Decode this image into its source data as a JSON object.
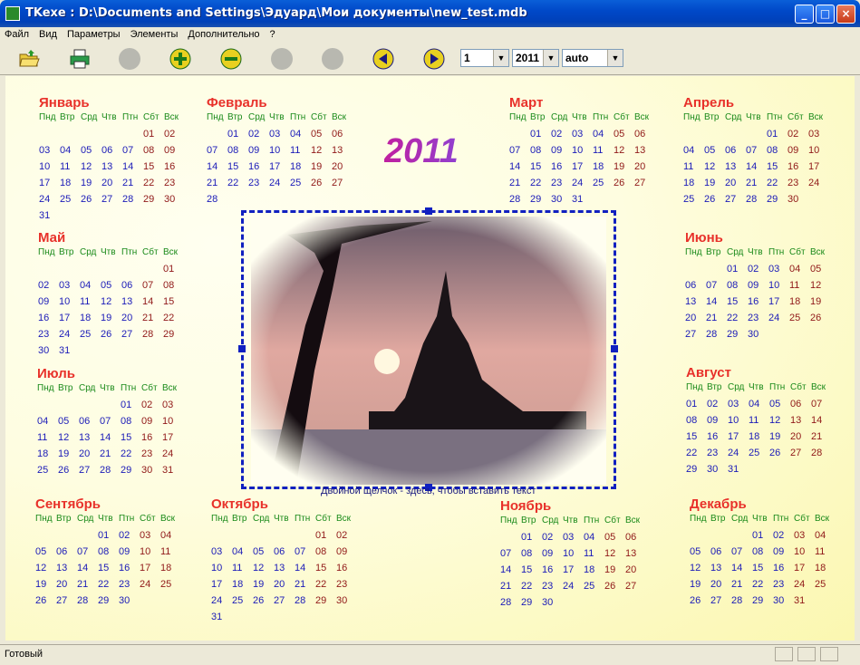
{
  "window": {
    "title": "TKexe : D:\\Documents and Settings\\Эдуард\\Мои документы\\new_test.mdb",
    "min": "_",
    "max": "□",
    "close": "×"
  },
  "menu": [
    "Файл",
    "Вид",
    "Параметры",
    "Элементы",
    "Дополнительно",
    "?"
  ],
  "toolbar": {
    "icons": [
      "open-folder-icon",
      "print-icon",
      "disabled-icon",
      "add-icon",
      "remove-icon",
      "disabled-icon",
      "disabled-icon",
      "prev-icon",
      "next-icon"
    ],
    "month_value": "1",
    "year_value": "2011",
    "mode_value": "auto"
  },
  "calendar": {
    "year": "2011",
    "weekdays": [
      "Пнд",
      "Втр",
      "Срд",
      "Чтв",
      "Птн",
      "Сбт",
      "Вск"
    ],
    "months": [
      {
        "name": "Январь",
        "offset": 5,
        "days": 31
      },
      {
        "name": "Февраль",
        "offset": 1,
        "days": 28
      },
      {
        "name": "Март",
        "offset": 1,
        "days": 31
      },
      {
        "name": "Апрель",
        "offset": 4,
        "days": 30
      },
      {
        "name": "Май",
        "offset": 6,
        "days": 31
      },
      {
        "name": "Июнь",
        "offset": 2,
        "days": 30
      },
      {
        "name": "Июль",
        "offset": 4,
        "days": 31
      },
      {
        "name": "Август",
        "offset": 0,
        "days": 31
      },
      {
        "name": "Сентябрь",
        "offset": 3,
        "days": 30
      },
      {
        "name": "Октябрь",
        "offset": 5,
        "days": 31
      },
      {
        "name": "Ноябрь",
        "offset": 1,
        "days": 30
      },
      {
        "name": "Декабрь",
        "offset": 3,
        "days": 31
      }
    ],
    "caption": "Двойной щелчок - здесь, чтобы вставить текст"
  },
  "status": {
    "text": "Готовый"
  },
  "colors": {
    "month_name": "#e8312a",
    "weekday": "#1a8a1a",
    "day": "#1a1ab8",
    "weekend": "#901818",
    "frame": "#1020c0"
  }
}
